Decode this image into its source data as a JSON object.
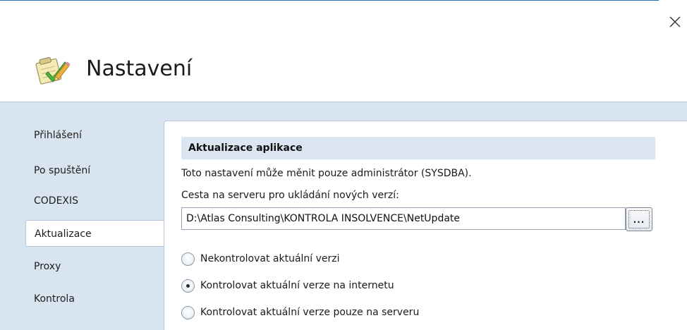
{
  "window": {
    "title": "Nastavení",
    "close_icon": "close-icon",
    "app_icon": "settings-checklist-icon"
  },
  "colors": {
    "accent_line": "#2b6fb5",
    "body_background": "#d9e4f1",
    "section_header_background": "#dce6f2"
  },
  "sidebar": {
    "items": [
      {
        "label": "Přihlášení",
        "active": false
      },
      {
        "label": "Po spuštění",
        "active": false
      },
      {
        "label": "CODEXIS",
        "active": false
      },
      {
        "label": "Aktualizace",
        "active": true
      },
      {
        "label": "Proxy",
        "active": false
      },
      {
        "label": "Kontrola",
        "active": false
      }
    ]
  },
  "content": {
    "section_title": "Aktualizace aplikace",
    "info_text": "Toto nastavení může měnit pouze administrátor (SYSDBA).",
    "path_label": "Cesta na serveru pro ukládání nových verzí:",
    "path_value": "D:\\Atlas Consulting\\KONTROLA INSOLVENCE\\NetUpdate",
    "browse_label": "...",
    "options": [
      {
        "label": "Nekontrolovat aktuální verzi",
        "selected": false
      },
      {
        "label": "Kontrolovat aktuální verze na internetu",
        "selected": true
      },
      {
        "label": "Kontrolovat aktuální verze pouze na serveru",
        "selected": false
      }
    ]
  }
}
